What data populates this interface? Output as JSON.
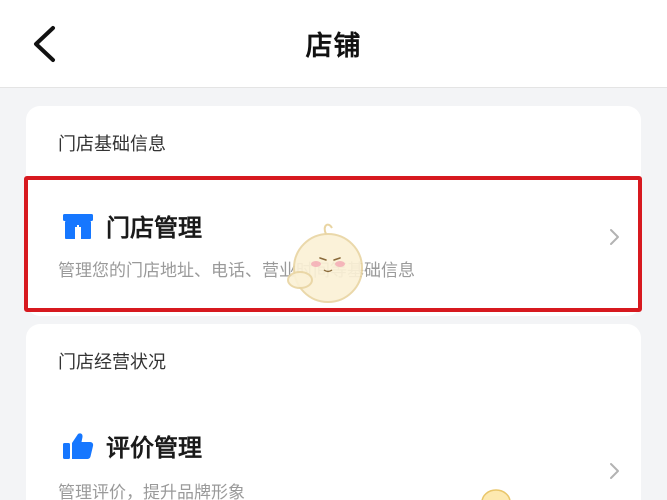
{
  "navbar": {
    "title": "店铺",
    "back_icon": "chevron-left-icon"
  },
  "sections": [
    {
      "header": "门店基础信息",
      "item": {
        "icon": "storefront-icon",
        "icon_color": "#1677ff",
        "title": "门店管理",
        "description": "管理您的门店地址、电话、营业时间等基础信息",
        "chevron_icon": "chevron-right-icon",
        "highlighted": true
      }
    },
    {
      "header": "门店经营状况",
      "item": {
        "icon": "thumbs-up-icon",
        "icon_color": "#1677ff",
        "title": "评价管理",
        "description": "管理评价，提升品牌形象",
        "chevron_icon": "chevron-right-icon",
        "highlighted": false
      }
    }
  ],
  "colors": {
    "highlight_border": "#d7191f",
    "accent": "#1677ff",
    "background": "#f3f4f6"
  }
}
